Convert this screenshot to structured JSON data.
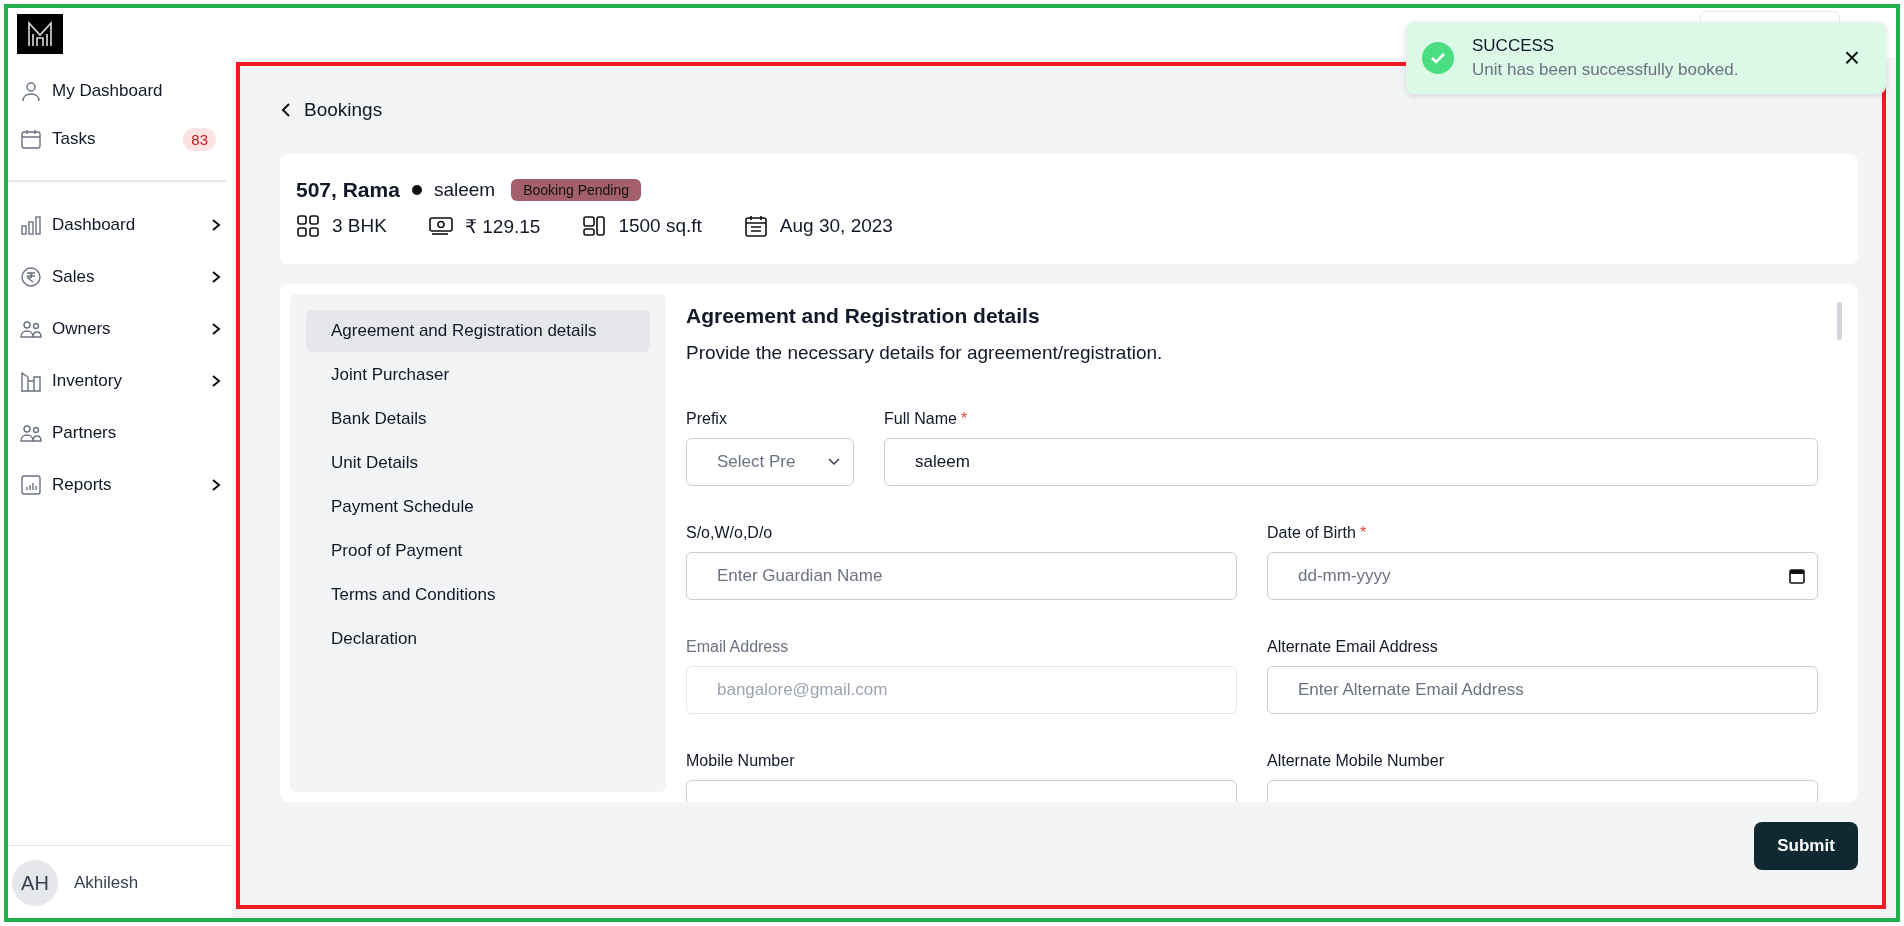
{
  "sidebar": {
    "user_items": [
      {
        "label": "My Dashboard"
      },
      {
        "label": "Tasks",
        "count": "83"
      }
    ],
    "nav_items": [
      {
        "label": "Dashboard",
        "expandable": true
      },
      {
        "label": "Sales",
        "expandable": true
      },
      {
        "label": "Owners",
        "expandable": true
      },
      {
        "label": "Inventory",
        "expandable": true
      },
      {
        "label": "Partners",
        "expandable": false
      },
      {
        "label": "Reports",
        "expandable": true
      }
    ],
    "user": {
      "initials": "AH",
      "name": "Akhilesh"
    }
  },
  "toast": {
    "title": "SUCCESS",
    "message": "Unit has been successfully booked.",
    "close": "×"
  },
  "back_link": "Bookings",
  "unit": {
    "title": "507, Rama",
    "owner": "saleem",
    "status": "Booking Pending",
    "facts": [
      "3 BHK",
      "₹ 129.15",
      "1500 sq.ft",
      "Aug 30, 2023"
    ]
  },
  "steps": [
    {
      "label": "Agreement and Registration details",
      "selected": true
    },
    {
      "label": "Joint Purchaser",
      "selected": false
    },
    {
      "label": "Bank Details",
      "selected": false
    },
    {
      "label": "Unit Details",
      "selected": false
    },
    {
      "label": "Payment Schedule",
      "selected": false
    },
    {
      "label": "Proof of Payment",
      "selected": false
    },
    {
      "label": "Terms and Conditions",
      "selected": false
    },
    {
      "label": "Declaration",
      "selected": false
    }
  ],
  "form": {
    "title": "Agreement and Registration details",
    "description": "Provide the necessary details for agreement/registration.",
    "rows": [
      [
        {
          "kind": "select",
          "label": "Prefix",
          "placeholder": "Select Pre",
          "disabled": false
        },
        {
          "kind": "text",
          "label": "Full Name",
          "required_mark": "*",
          "value": "saleem",
          "disabled": false
        }
      ],
      [
        {
          "kind": "text",
          "label": "S/o,W/o,D/o",
          "placeholder": "Enter Guardian Name",
          "disabled": false
        },
        {
          "kind": "date",
          "label": "Date of Birth",
          "required_mark": "*",
          "placeholder": "dd-mm-yyyy",
          "disabled": false
        }
      ],
      [
        {
          "kind": "text",
          "label": "Email Address",
          "placeholder": "bangalore@gmail.com",
          "disabled": true
        },
        {
          "kind": "text",
          "label": "Alternate Email Address",
          "placeholder": "Enter Alternate Email Address",
          "disabled": false
        }
      ],
      [
        {
          "kind": "text",
          "label": "Mobile Number",
          "disabled": false
        },
        {
          "kind": "text",
          "label": "Alternate Mobile Number",
          "disabled": false
        }
      ]
    ]
  },
  "submit": "Submit"
}
